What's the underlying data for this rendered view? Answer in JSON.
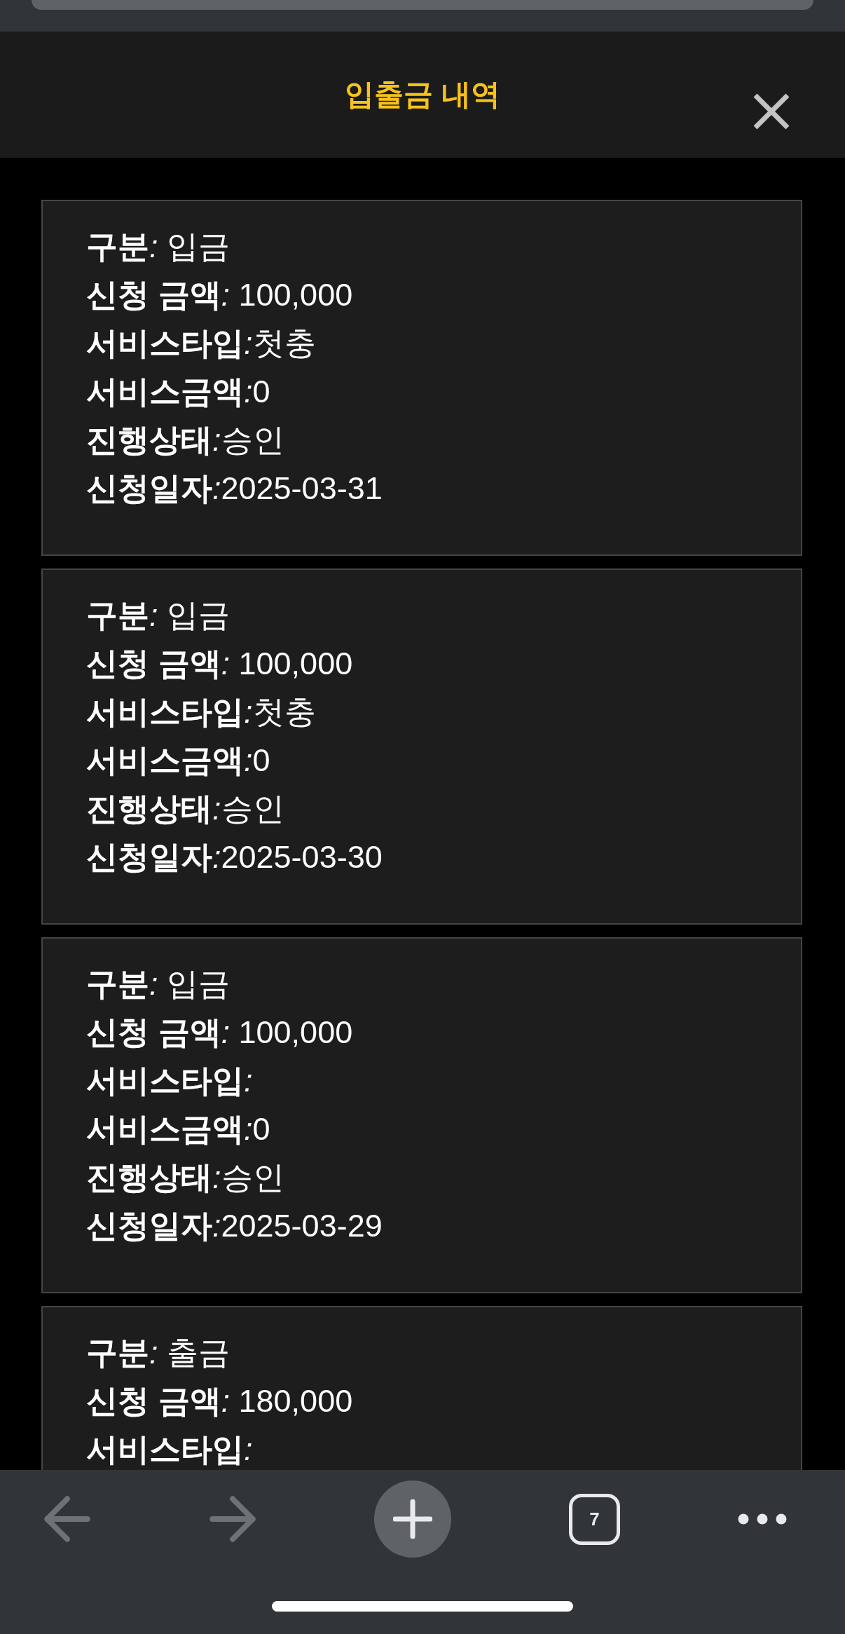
{
  "dialog": {
    "title": "입출금 내역"
  },
  "records": [
    {
      "rows": [
        {
          "label": "구분",
          "separator": ": ",
          "value": "입금"
        },
        {
          "label": "신청 금액",
          "separator": ": ",
          "value": "100,000"
        },
        {
          "label": "서비스타입",
          "separator": ":",
          "value": "첫충"
        },
        {
          "label": "서비스금액",
          "separator": ":",
          "value": "0"
        },
        {
          "label": "진행상태",
          "separator": ":",
          "value": "승인"
        },
        {
          "label": "신청일자",
          "separator": ":",
          "value": "2025-03-31"
        }
      ]
    },
    {
      "rows": [
        {
          "label": "구분",
          "separator": ": ",
          "value": "입금"
        },
        {
          "label": "신청 금액",
          "separator": ": ",
          "value": "100,000"
        },
        {
          "label": "서비스타입",
          "separator": ":",
          "value": "첫충"
        },
        {
          "label": "서비스금액",
          "separator": ":",
          "value": "0"
        },
        {
          "label": "진행상태",
          "separator": ":",
          "value": "승인"
        },
        {
          "label": "신청일자",
          "separator": ":",
          "value": "2025-03-30"
        }
      ]
    },
    {
      "rows": [
        {
          "label": "구분",
          "separator": ": ",
          "value": "입금"
        },
        {
          "label": "신청 금액",
          "separator": ": ",
          "value": "100,000"
        },
        {
          "label": "서비스타입",
          "separator": ":"
        },
        {
          "label": "서비스금액",
          "separator": ":",
          "value": "0"
        },
        {
          "label": "진행상태",
          "separator": ":",
          "value": "승인"
        },
        {
          "label": "신청일자",
          "separator": ":",
          "value": "2025-03-29"
        }
      ]
    },
    {
      "rows": [
        {
          "label": "구분",
          "separator": ": ",
          "value": "출금"
        },
        {
          "label": "신청 금액",
          "separator": ": ",
          "value": "180,000"
        },
        {
          "label": "서비스타입",
          "separator": ":"
        }
      ]
    }
  ],
  "toolbar": {
    "back": {
      "disabled": true
    },
    "forward": {
      "disabled": true
    },
    "tab_count": "7"
  }
}
